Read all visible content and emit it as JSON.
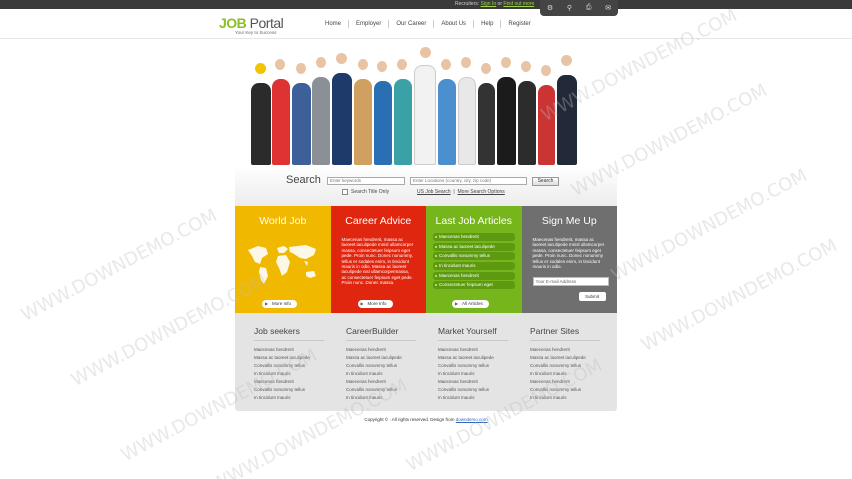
{
  "topbar": {
    "recruiters_prefix": "Recruiters:",
    "sign_in": "Sign In",
    "or": "or",
    "find_out_more": "Find out more",
    "icons": [
      "gear-icon",
      "search-icon",
      "print-icon",
      "mail-icon"
    ]
  },
  "header": {
    "logo_job": "JOB",
    "logo_portal": " Portal",
    "tagline": "Your Key to Success",
    "nav": [
      "Home",
      "Employer",
      "Our Career",
      "About Us",
      "Help",
      "Register"
    ]
  },
  "search": {
    "label": "Search",
    "keywords_placeholder": "Enter keywords",
    "location_placeholder": "Enter Locations (country, city, zip code)",
    "button": "Search",
    "title_only": "Search Title Only",
    "us_job_search": "US Job Search",
    "separator": "|",
    "more_options": "More Search Options"
  },
  "boxes": {
    "world": {
      "title": "World Job",
      "button": "More Info"
    },
    "career": {
      "title": "Career Advice",
      "text": "Maecenas hendrerit, massa ac laoreet iaculipede mnisl ullamcorper massa, consectetuer feipsum eget pede. Proin nunc. Donec nonummy, tellus er sodales enim, in tincidunt mauris in odio. Massa ac laoreet iaculipede nisl ullamcorpermassa, ac consectetuer feipsum eget pede. Proin nunc. Donec massa.",
      "button": "More Info"
    },
    "articles": {
      "title": "Last Job Articles",
      "items": [
        "Maecenas hendrerit",
        "Massa ac laoreet iaculipede",
        "Convallis nonummy tellus",
        "In tincidunt mauris",
        "Maecenas hendrerit",
        "Consectetuer feipsum eget"
      ],
      "button": "All Articles"
    },
    "signme": {
      "title": "Sign Me Up",
      "text": "Maecenas hendrerit, massa ac laoreet iaculipede mnisl ullamcorper massa, consectetuer feipsum eget pede. Proin nunc. Donec nonummy tellus er sodales enim, in tincidunt mauris in odio.",
      "email_placeholder": "Your E-mail Address",
      "button": "Submit"
    }
  },
  "columns": [
    {
      "title": "Job seekers",
      "items": [
        "Maecenas hendrerit",
        "Massa ac laoreet iaculipede",
        "Convallis nonummy tellus",
        "In tincidunt mauris",
        "Maecenas hendrerit",
        "Convallis nonummy tellus",
        "In tincidunt mauris"
      ]
    },
    {
      "title": "CareerBuilder",
      "items": [
        "Maecenas hendrerit",
        "Massa ac laoreet iaculipede",
        "Convallis nonummy tellus",
        "In tincidunt mauris",
        "Maecenas hendrerit",
        "Convallis nonummy tellus",
        "In tincidunt mauris"
      ]
    },
    {
      "title": "Market Yourself",
      "items": [
        "Maecenas hendrerit",
        "Massa ac laoreet iaculipede",
        "Convallis nonummy tellus",
        "In tincidunt mauris",
        "Maecenas hendrerit",
        "Convallis nonummy tellus",
        "In tincidunt mauris"
      ]
    },
    {
      "title": "Partner Sites",
      "items": [
        "Maecenas hendrerit",
        "Massa ac laoreet iaculipede",
        "Convallis nonummy tellus",
        "In tincidunt mauris",
        "Maecenas hendrerit",
        "Convallis nonummy tellus",
        "In tincidunt mauris"
      ]
    }
  ],
  "footer": {
    "copyright": "Copyright © . All rights reserved. Design from",
    "link": "downdemo.com"
  },
  "watermark": "WWW.DOWNDEMO.COM",
  "colors": {
    "world": "#f1b800",
    "career": "#e1260f",
    "articles": "#77b51d",
    "signme": "#6f6f6f",
    "logo_green": "#8cbf26"
  }
}
